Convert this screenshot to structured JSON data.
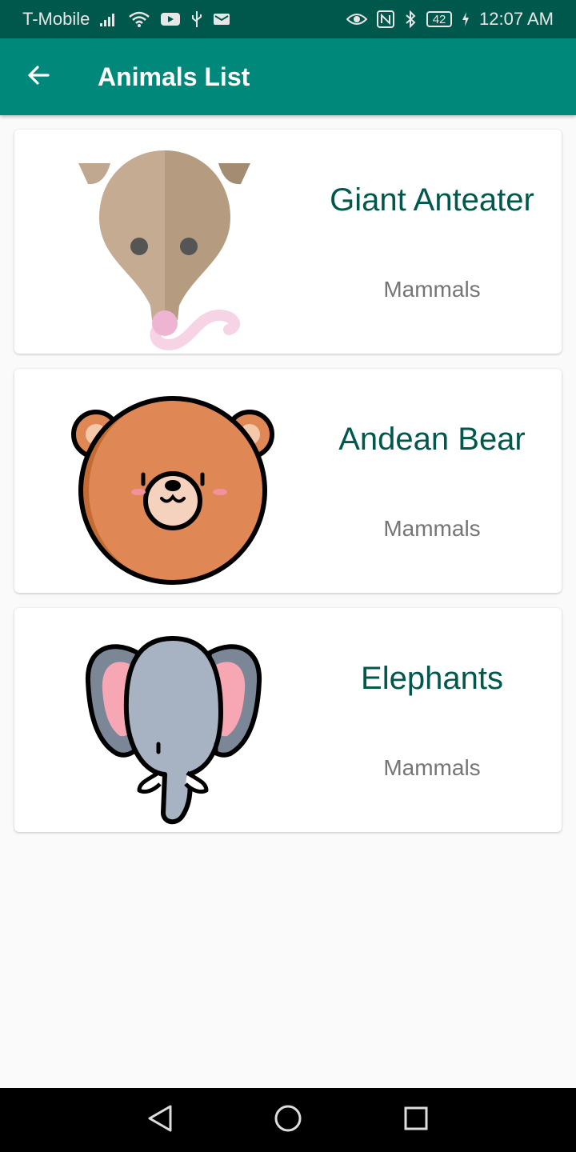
{
  "status_bar": {
    "carrier": "T-Mobile",
    "battery": "42",
    "time": "12:07 AM",
    "left_icons": [
      "signal-icon",
      "wifi-icon",
      "youtube-icon",
      "usb-icon",
      "mail-icon"
    ],
    "right_icons": [
      "eye-icon",
      "nfc-icon",
      "bluetooth-icon",
      "battery-icon",
      "charging-icon"
    ]
  },
  "app_bar": {
    "title": "Animals List",
    "back_icon": "arrow-back-icon",
    "color": "#00897b",
    "dark_color": "#00574b"
  },
  "animals": [
    {
      "name": "Giant Anteater",
      "category": "Mammals",
      "image": "anteater-icon"
    },
    {
      "name": "Andean Bear",
      "category": "Mammals",
      "image": "bear-icon"
    },
    {
      "name": "Elephants",
      "category": "Mammals",
      "image": "elephant-icon"
    }
  ],
  "nav_bar": {
    "buttons": [
      "back-triangle-icon",
      "home-circle-icon",
      "recents-square-icon"
    ]
  },
  "colors": {
    "title_text": "#00574b",
    "subtitle_text": "#757575",
    "background": "#fafafa"
  }
}
